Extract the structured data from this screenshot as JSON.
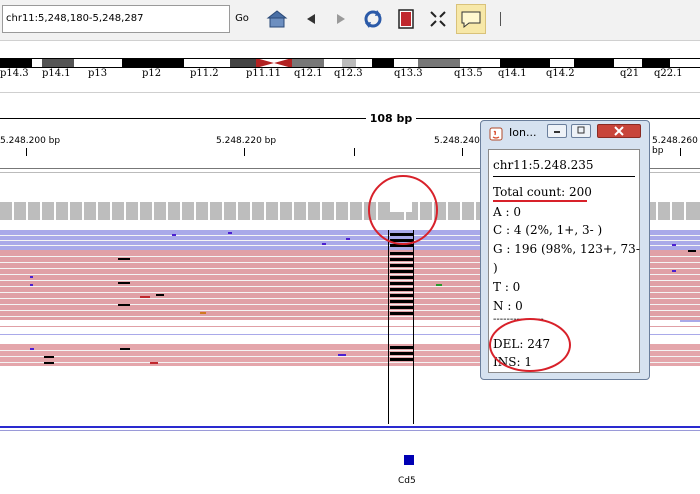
{
  "toolbar": {
    "locus": "chr11:5,248,180-5,248,287",
    "go_label": "Go"
  },
  "cytobands": [
    "p14.3",
    "p14.1",
    "p13",
    "p12",
    "p11.2",
    "p11.11",
    "q12.1",
    "q12.3",
    "q13.3",
    "q13.5",
    "q14.1",
    "q14.2",
    "q21",
    "q22.1"
  ],
  "ruler": {
    "span": "108 bp",
    "ticks": [
      "5.248.200 bp",
      "5.248.220 bp",
      "5.248.240 bp",
      "5.248.260 bp"
    ]
  },
  "gene": {
    "name": "Cd5"
  },
  "popup": {
    "title": "Ion...",
    "position": "chr11:5.248.235",
    "total_count": "Total count: 200",
    "a": "A : 0",
    "c": "C : 4 (2%, 1+, 3- )",
    "g_line1": "G : 196 (98%, 123+, 73-",
    "g_line2": ")",
    "t": "T : 0",
    "n": "N : 0",
    "divider": "---------------",
    "del": "DEL: 247",
    "ins": "INS: 1"
  },
  "colors": {
    "forward_read": "#a9a9e9",
    "reverse_read": "#e0a0a6",
    "coverage": "#bdbdbd",
    "annotation": "#d8212a",
    "gene": "#0000b4"
  }
}
